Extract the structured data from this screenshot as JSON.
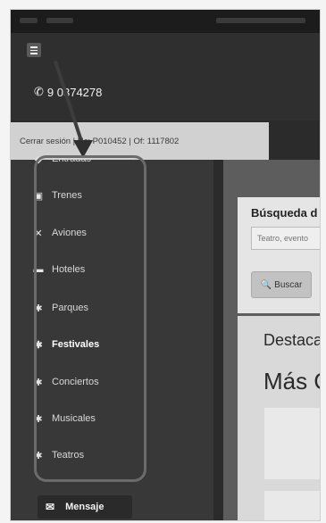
{
  "header": {
    "phone": "9 0374278"
  },
  "session": {
    "text": "Cerrar sesión | Uc: P010452 | Of: 1117802"
  },
  "sidebar": {
    "items": [
      {
        "label": "Entradas",
        "icon": "ticket-icon",
        "glyph": "◆"
      },
      {
        "label": "Trenes",
        "icon": "train-icon",
        "glyph": "▣"
      },
      {
        "label": "Aviones",
        "icon": "plane-icon",
        "glyph": "✕"
      },
      {
        "label": "Hoteles",
        "icon": "bed-icon",
        "glyph": "▬"
      },
      {
        "label": "Parques",
        "icon": "gear-icon",
        "glyph": "✱"
      },
      {
        "label": "Festivales",
        "icon": "gear-icon",
        "glyph": "✱",
        "active": true
      },
      {
        "label": "Conciertos",
        "icon": "gear-icon",
        "glyph": "✱"
      },
      {
        "label": "Musicales",
        "icon": "gear-icon",
        "glyph": "✱"
      },
      {
        "label": "Teatros",
        "icon": "gear-icon",
        "glyph": "✱"
      }
    ]
  },
  "message": {
    "label": "Mensaje",
    "icon": "envelope-icon"
  },
  "search": {
    "title": "Búsqueda d",
    "placeholder": "Teatro, evento",
    "button_label": "Buscar",
    "button_icon": "search-icon"
  },
  "content": {
    "heading1": "Destaca",
    "heading2": "Más O"
  }
}
